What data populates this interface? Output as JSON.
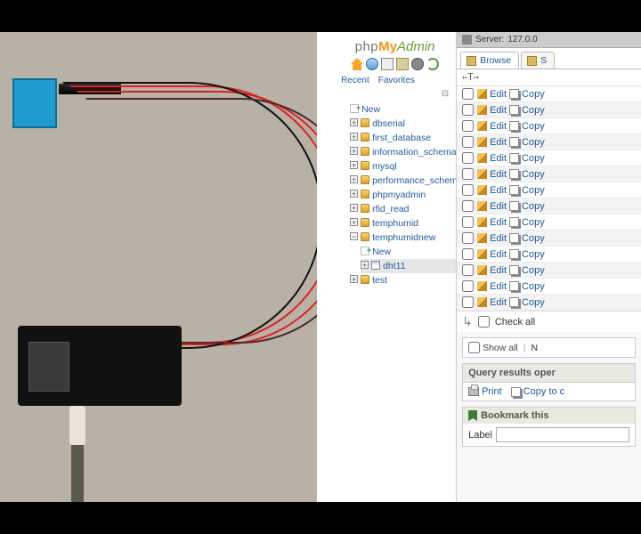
{
  "logo": {
    "p1": "php",
    "p2": "My",
    "p3": "Admin"
  },
  "nav_tabs": {
    "recent": "Recent",
    "favorites": "Favorites"
  },
  "tree": {
    "new": "New",
    "dbs": [
      "dbserial",
      "first_database",
      "information_schema",
      "mysql",
      "performance_schema",
      "phpmyadmin",
      "rfid_read",
      "temphumid"
    ],
    "open_db": "temphumidnew",
    "open_new": "New",
    "open_table": "dht11",
    "last": "test"
  },
  "server": {
    "prefix": "Server:",
    "value": "127.0.0"
  },
  "tabs": {
    "browse": "Browse",
    "next": "S"
  },
  "toolbar": {
    "arrow": "←T→"
  },
  "row": {
    "edit": "Edit",
    "copy": "Copy"
  },
  "rows_count": 14,
  "checkall": {
    "label": "Check all"
  },
  "showall": {
    "label": "Show all"
  },
  "filter": {
    "next": "N"
  },
  "qro": {
    "title": "Query results oper"
  },
  "print": {
    "print": "Print",
    "copy": "Copy to c"
  },
  "bookmark": {
    "title": "Bookmark this",
    "label": "Label"
  }
}
